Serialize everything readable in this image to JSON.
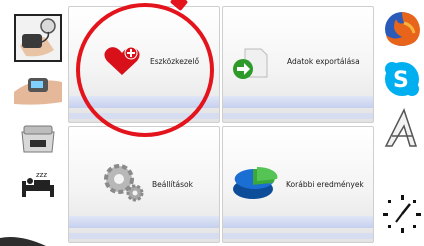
{
  "left_devices": [
    {
      "icon": "blood-pressure-monitor-icon",
      "selected": true
    },
    {
      "icon": "pulse-oximeter-icon",
      "selected": false
    },
    {
      "icon": "weighing-scale-icon",
      "selected": false
    },
    {
      "icon": "sleep-bed-icon",
      "selected": false
    }
  ],
  "tiles": {
    "devices": {
      "label": "Eszközkezelő",
      "icon": "heart-plus-icon"
    },
    "export": {
      "label": "Adatok exportálása",
      "icon": "document-export-icon"
    },
    "settings": {
      "label": "Beállítások",
      "icon": "gears-icon"
    },
    "history": {
      "label": "Korábbi eredmények",
      "icon": "pie-chart-icon"
    }
  },
  "right_apps": [
    {
      "icon": "firefox-icon"
    },
    {
      "icon": "skype-icon"
    },
    {
      "icon": "inkscape-icon"
    },
    {
      "icon": "clock-icon"
    }
  ],
  "colors": {
    "highlight": "#e3141c",
    "heart": "#d8101a",
    "export_arrow": "#2e9a2a",
    "pie_blue": "#1c6fd2",
    "pie_green": "#3aa83a"
  },
  "sleep_glyph": "zzz"
}
